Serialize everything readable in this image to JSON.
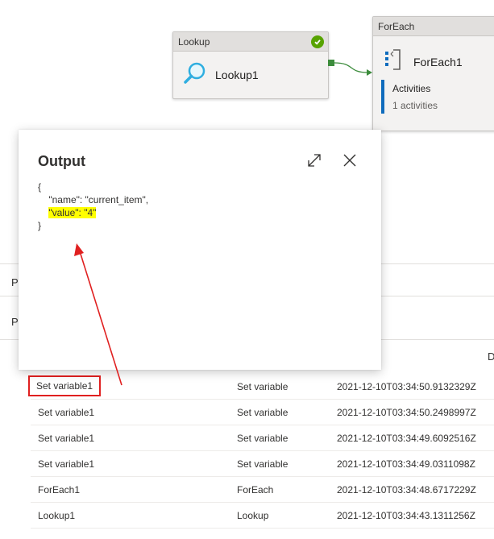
{
  "canvas": {
    "lookup_node": {
      "type_label": "Lookup",
      "name": "Lookup1",
      "status": "succeeded",
      "icon": "search-icon",
      "status_color": "#57a300"
    },
    "foreach_node": {
      "type_label": "ForEach",
      "name": "ForEach1",
      "icon": "foreach-icon",
      "activities_label": "Activities",
      "activities_count": "1 activities",
      "accent_color": "#0f6cbd"
    }
  },
  "background": {
    "tab_letter_1": "P",
    "tab_letter_2": "P",
    "column_header_partial": "D"
  },
  "output_popup": {
    "title": "Output",
    "expand_icon": "expand-icon",
    "close_icon": "close-icon",
    "json_lines": {
      "open": "{",
      "name_line": "    \"name\": \"current_item\",",
      "value_line": "\"value\": \"4\"",
      "close": "}"
    },
    "highlight_color": "#ffff00"
  },
  "activity_runs": [
    {
      "name": "Set variable1",
      "type": "Set variable",
      "start": "2021-12-10T03:34:50.9132329Z",
      "highlighted": true
    },
    {
      "name": "Set variable1",
      "type": "Set variable",
      "start": "2021-12-10T03:34:50.2498997Z"
    },
    {
      "name": "Set variable1",
      "type": "Set variable",
      "start": "2021-12-10T03:34:49.6092516Z"
    },
    {
      "name": "Set variable1",
      "type": "Set variable",
      "start": "2021-12-10T03:34:49.0311098Z"
    },
    {
      "name": "ForEach1",
      "type": "ForEach",
      "start": "2021-12-10T03:34:48.6717229Z"
    },
    {
      "name": "Lookup1",
      "type": "Lookup",
      "start": "2021-12-10T03:34:43.1311256Z"
    }
  ],
  "annotation": {
    "color": "#e02020"
  }
}
